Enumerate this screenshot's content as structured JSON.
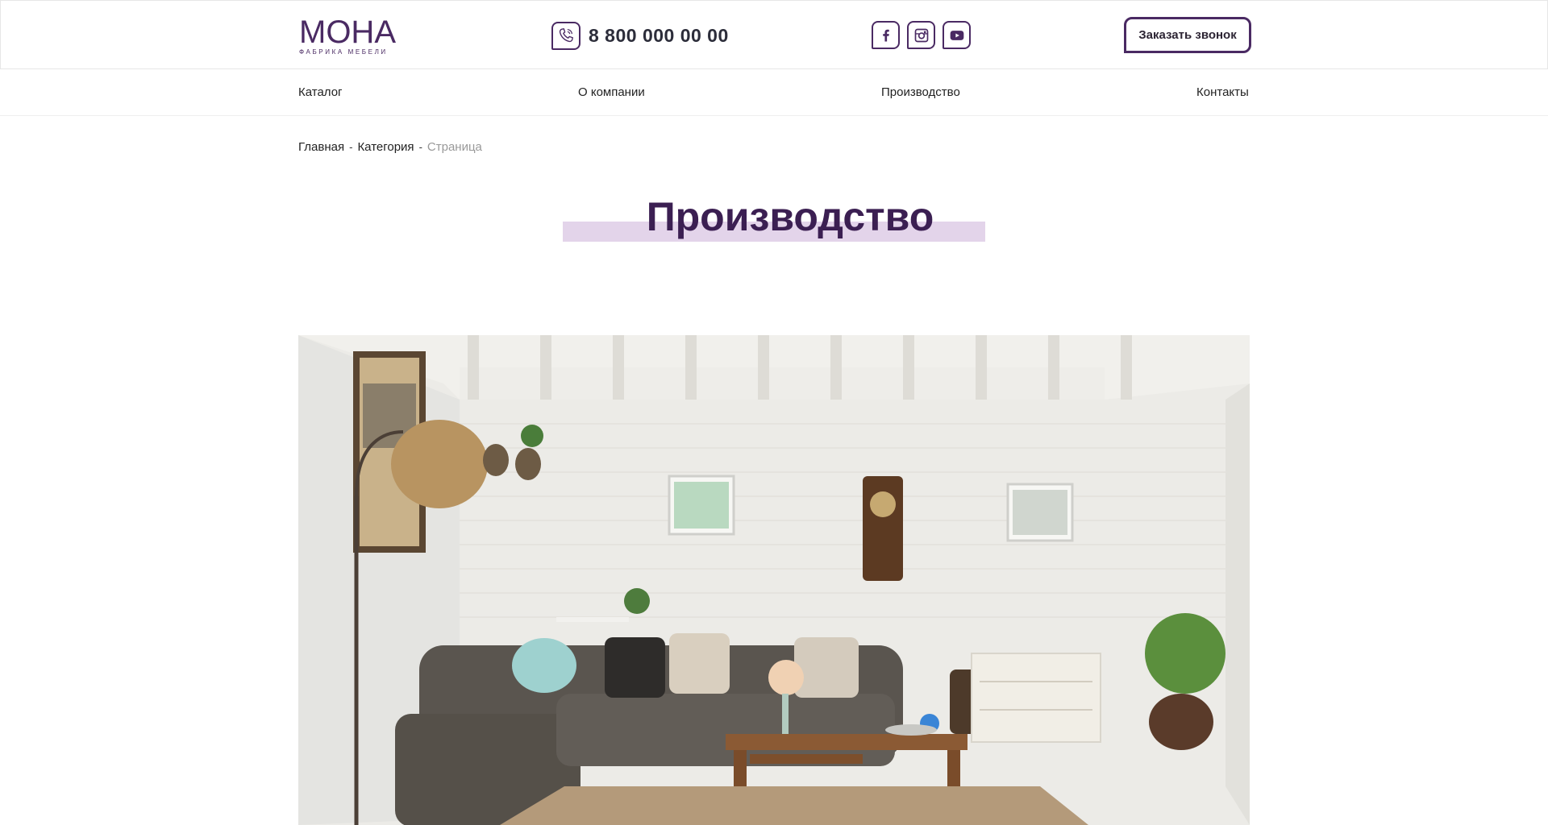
{
  "header": {
    "logo": {
      "name": "МОНА",
      "tagline": "ФАБРИКА МЕБЕЛИ"
    },
    "phone": {
      "icon": "phone-icon",
      "number": "8 800 000 00 00"
    },
    "socials": [
      {
        "name": "facebook-icon"
      },
      {
        "name": "instagram-icon"
      },
      {
        "name": "youtube-icon"
      }
    ],
    "callback_label": "Заказать звонок"
  },
  "nav": {
    "items": [
      {
        "label": "Каталог"
      },
      {
        "label": "О компании"
      },
      {
        "label": "Производство"
      },
      {
        "label": "Контакты"
      }
    ]
  },
  "breadcrumb": {
    "items": [
      {
        "label": "Главная"
      },
      {
        "label": "Категория"
      }
    ],
    "separator": "-",
    "current": "Страница"
  },
  "page": {
    "title": "Производство"
  },
  "colors": {
    "brand": "#4a2a63",
    "title": "#3b1f52",
    "highlight": "#e3d4ea",
    "muted": "#999999"
  },
  "hero": {
    "scene": "living-room-photo"
  }
}
